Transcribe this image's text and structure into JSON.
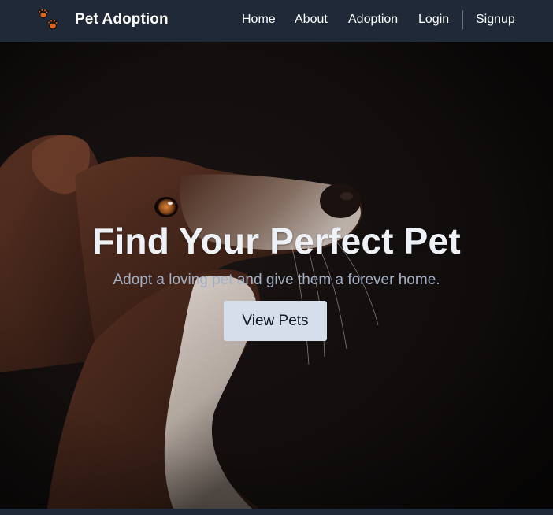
{
  "navbar": {
    "brand_icon": "paw-prints-icon",
    "brand_title": "Pet Adoption",
    "links": [
      "Home",
      "About",
      "Adoption",
      "Login",
      "Signup"
    ]
  },
  "hero": {
    "background": "dog-profile-photo",
    "title": "Find Your Perfect Pet",
    "subtitle": "Adopt a loving pet and give them a forever home.",
    "button_label": "View Pets"
  },
  "colors": {
    "navbar_bg": "#1f2937",
    "paw_orange": "#e0621b",
    "button_bg": "#d6dee9",
    "title_text": "#eef2f7",
    "subtitle_text": "#a3b0c4"
  }
}
